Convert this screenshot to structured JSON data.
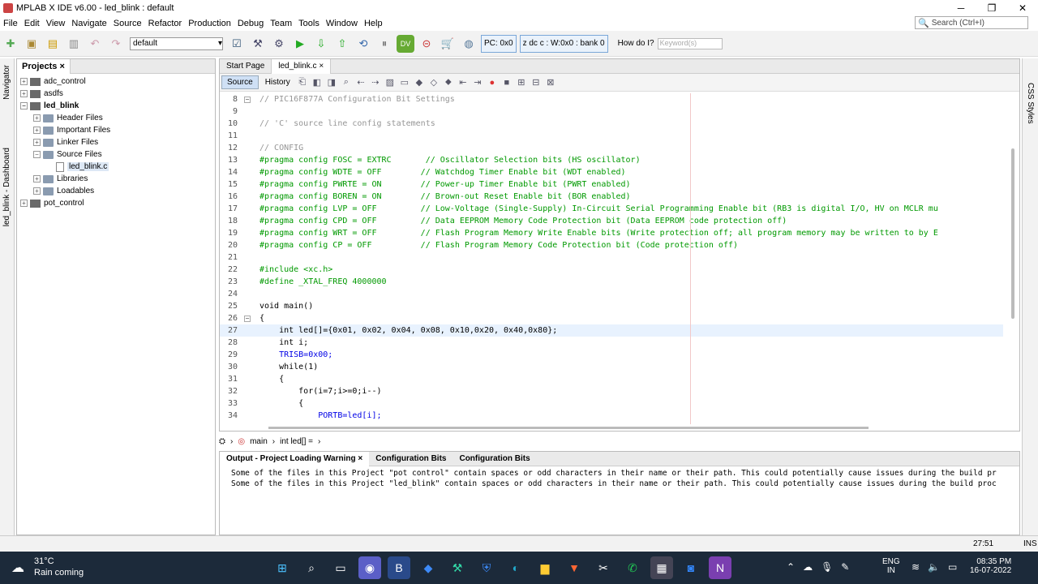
{
  "window": {
    "title": "MPLAB X IDE v6.00 - led_blink : default",
    "min": "─",
    "max": "❐",
    "close": "✕"
  },
  "menu": [
    "File",
    "Edit",
    "View",
    "Navigate",
    "Source",
    "Refactor",
    "Production",
    "Debug",
    "Team",
    "Tools",
    "Window",
    "Help"
  ],
  "search": {
    "placeholder": "Search (Ctrl+I)"
  },
  "toolbar": {
    "config": "default",
    "pc": "PC: 0x0",
    "status": "z dc c  : W:0x0 : bank 0",
    "howdo": "How do I?",
    "keyword_placeholder": "Keyword(s)"
  },
  "left_strip": {
    "navigator": "Navigator",
    "dashboard": "led_blink - Dashboard"
  },
  "projects": {
    "tab": "Projects",
    "close": "×",
    "items": [
      "adc_control",
      "asdfs",
      "led_blink",
      "Header Files",
      "Important Files",
      "Linker Files",
      "Source Files",
      "led_blink.c",
      "Libraries",
      "Loadables",
      "pot_control"
    ]
  },
  "editor": {
    "tabs": [
      "Start Page",
      "led_blink.c"
    ],
    "modes": [
      "Source",
      "History"
    ],
    "lines": [
      {
        "n": "8",
        "t": "// PIC16F877A Configuration Bit Settings"
      },
      {
        "n": "9",
        "t": ""
      },
      {
        "n": "10",
        "t": "// 'C' source line config statements"
      },
      {
        "n": "11",
        "t": ""
      },
      {
        "n": "12",
        "t": "// CONFIG"
      },
      {
        "n": "13",
        "t": "#pragma config FOSC = EXTRC       // Oscillator Selection bits (HS oscillator)"
      },
      {
        "n": "14",
        "t": "#pragma config WDTE = OFF        // Watchdog Timer Enable bit (WDT enabled)"
      },
      {
        "n": "15",
        "t": "#pragma config PWRTE = ON        // Power-up Timer Enable bit (PWRT enabled)"
      },
      {
        "n": "16",
        "t": "#pragma config BOREN = ON        // Brown-out Reset Enable bit (BOR enabled)"
      },
      {
        "n": "17",
        "t": "#pragma config LVP = OFF         // Low-Voltage (Single-Supply) In-Circuit Serial Programming Enable bit (RB3 is digital I/O, HV on MCLR mu"
      },
      {
        "n": "18",
        "t": "#pragma config CPD = OFF         // Data EEPROM Memory Code Protection bit (Data EEPROM code protection off)"
      },
      {
        "n": "19",
        "t": "#pragma config WRT = OFF         // Flash Program Memory Write Enable bits (Write protection off; all program memory may be written to by E"
      },
      {
        "n": "20",
        "t": "#pragma config CP = OFF          // Flash Program Memory Code Protection bit (Code protection off)"
      },
      {
        "n": "21",
        "t": ""
      },
      {
        "n": "22",
        "t": "#include <xc.h>"
      },
      {
        "n": "23",
        "t": "#define _XTAL_FREQ 4000000"
      },
      {
        "n": "24",
        "t": ""
      },
      {
        "n": "25",
        "t": "void main()"
      },
      {
        "n": "26",
        "t": "{"
      },
      {
        "n": "27",
        "t": "    int led[]={0x01, 0x02, 0x04, 0x08, 0x10,0x20, 0x40,0x80};"
      },
      {
        "n": "28",
        "t": "    int i;"
      },
      {
        "n": "29",
        "t": "    TRISB=0x00;"
      },
      {
        "n": "30",
        "t": "    while(1)"
      },
      {
        "n": "31",
        "t": "    {"
      },
      {
        "n": "32",
        "t": "        for(i=7;i>=0;i--)"
      },
      {
        "n": "33",
        "t": "        {"
      },
      {
        "n": "34",
        "t": "            PORTB=led[i];"
      }
    ]
  },
  "navbar": {
    "fn": "main",
    "var": "int led[] ="
  },
  "output": {
    "tabs": [
      "Output - Project Loading Warning",
      "Configuration Bits",
      "Configuration Bits"
    ],
    "lines": [
      "Some of the files in this Project \"pot control\" contain spaces or odd characters in their name or their path. This could potentially cause issues during the build pr",
      "Some of the files in this Project \"led_blink\" contain spaces or odd characters in their name or their path. This could potentially cause issues during the build proc"
    ]
  },
  "right_strip": {
    "css": "CSS Styles"
  },
  "status": {
    "pos": "27:51",
    "ins": "INS"
  },
  "taskbar": {
    "temp": "31°C",
    "weather": "Rain coming",
    "lang1": "ENG",
    "lang2": "IN",
    "time": "08:35 PM",
    "date": "16-07-2022"
  }
}
